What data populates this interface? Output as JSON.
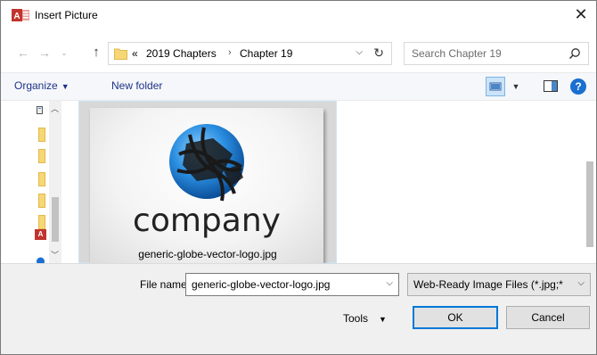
{
  "window": {
    "title": "Insert Picture",
    "app_icon_letter": "A",
    "close_symbol": "✕"
  },
  "address_bar": {
    "overflow_marker": "«",
    "breadcrumbs": [
      "2019 Chapters",
      "Chapter 19"
    ],
    "separator": "›",
    "dropdown_symbol": "⌵",
    "refresh_symbol": "↻"
  },
  "search": {
    "placeholder": "Search Chapter 19",
    "icon": "search-icon"
  },
  "toolbar": {
    "organize_label": "Organize",
    "new_folder_label": "New folder",
    "help_label": "?"
  },
  "content": {
    "items": [
      {
        "file_name": "generic-globe-vector-logo.jpg",
        "thumbnail_text": "company",
        "selected": true
      }
    ]
  },
  "footer": {
    "file_name_label": "File name:",
    "file_name_value": "generic-globe-vector-logo.jpg",
    "file_type_value": "Web-Ready Image Files (*.jpg;*",
    "tools_label": "Tools",
    "ok_label": "OK",
    "cancel_label": "Cancel"
  },
  "colors": {
    "accent": "#0078d7",
    "selection": "#cce4f7",
    "link_text": "#1e3287",
    "access_red": "#c0342d"
  }
}
